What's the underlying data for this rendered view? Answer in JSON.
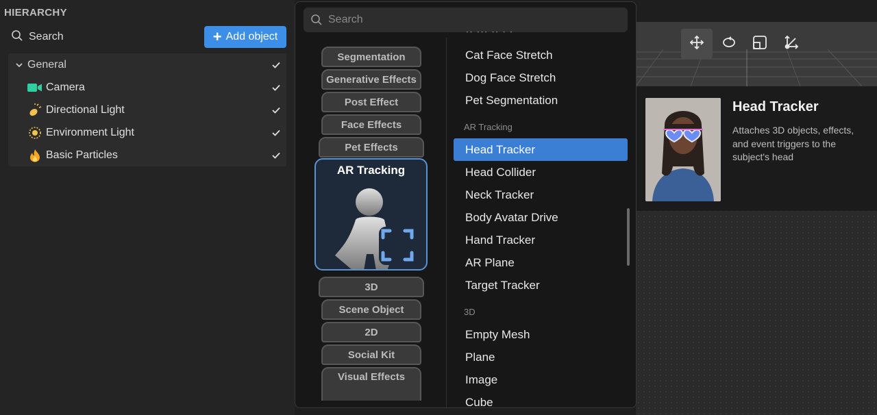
{
  "hierarchy": {
    "title": "HIERARCHY",
    "search_label": "Search",
    "add_button": "Add object",
    "group": "General",
    "items": [
      {
        "label": "Camera",
        "icon": "camera-icon"
      },
      {
        "label": "Directional Light",
        "icon": "directional-light-icon"
      },
      {
        "label": "Environment Light",
        "icon": "environment-light-icon"
      },
      {
        "label": "Basic Particles",
        "icon": "fire-icon"
      }
    ]
  },
  "popup": {
    "search_placeholder": "Search",
    "categories": [
      "Segmentation",
      "Generative Effects",
      "Post Effect",
      "Face Effects",
      "Pet Effects",
      "AR Tracking",
      "3D",
      "Scene Object",
      "2D",
      "Social Kit",
      "Visual Effects"
    ],
    "active_category": "AR Tracking",
    "top_items": [
      "Cat Face Stretch",
      "Dog Face Stretch",
      "Pet Segmentation"
    ],
    "ar_section": "AR Tracking",
    "ar_items": [
      "Head Tracker",
      "Head Collider",
      "Neck Tracker",
      "Body Avatar Drive",
      "Hand Tracker",
      "AR Plane",
      "Target Tracker"
    ],
    "selected_item": "Head Tracker",
    "section_3d": "3D",
    "items_3d": [
      "Empty Mesh",
      "Plane",
      "Image",
      "Cube"
    ]
  },
  "preview": {
    "title": "Head Tracker",
    "description": "Attaches 3D objects, effects, and event triggers to the subject's head"
  },
  "colors": {
    "accent": "#3d8ee6",
    "selected": "#3a7fd4",
    "active_border": "#5a93d6",
    "check": "#e0e0e0",
    "camera_icon": "#2fcf9f"
  }
}
